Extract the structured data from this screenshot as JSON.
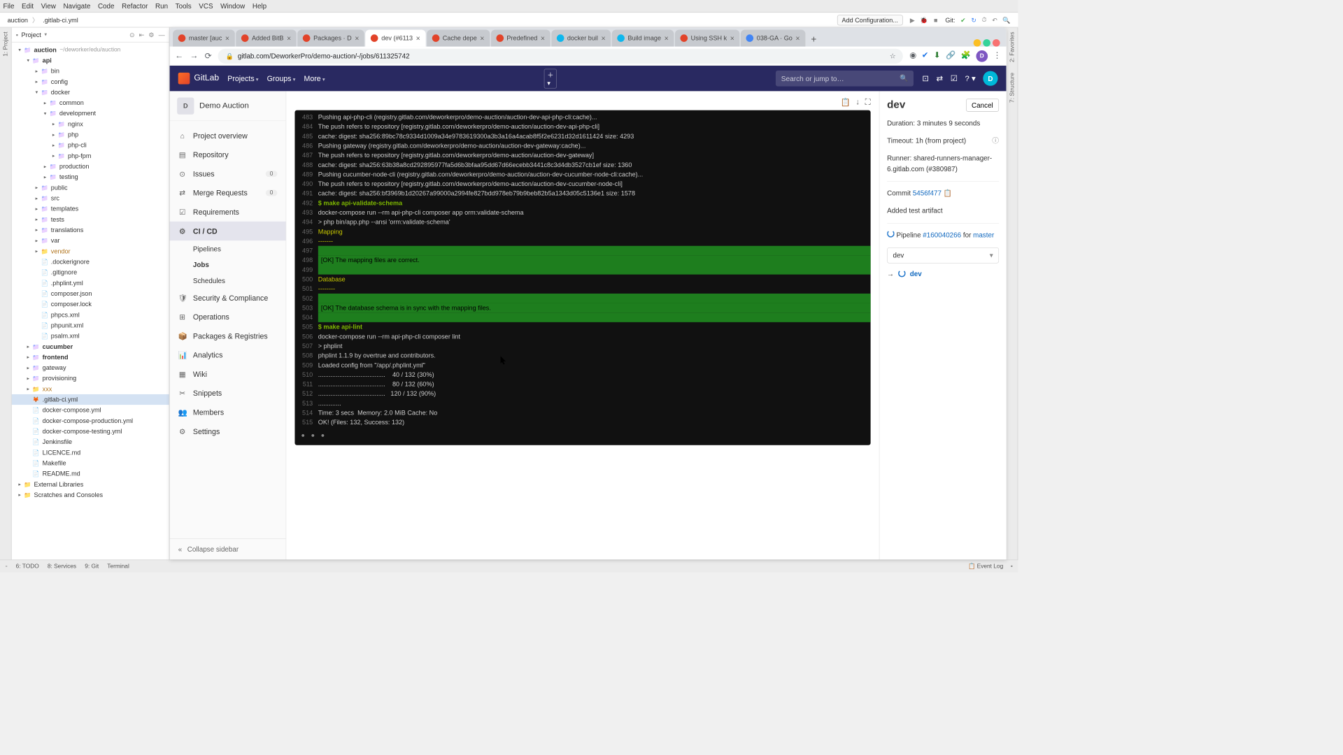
{
  "ide": {
    "menubar": [
      "File",
      "Edit",
      "View",
      "Navigate",
      "Code",
      "Refactor",
      "Run",
      "Tools",
      "VCS",
      "Window",
      "Help"
    ],
    "breadcrumb": {
      "project": "auction",
      "file": ".gitlab-ci.yml",
      "add_config": "Add Configuration...",
      "git": "Git:"
    },
    "gutter_left": [
      "1: Project"
    ],
    "gutter_left2": [
      "2: Favorites",
      "7: Structure"
    ],
    "sidebar_title": "Project",
    "tree": [
      {
        "d": 0,
        "a": "▾",
        "icon": "folder-blue",
        "t": "auction",
        "hint": "~/deworker/edu/auction",
        "bold": true
      },
      {
        "d": 1,
        "a": "▾",
        "icon": "folder-blue",
        "t": "api",
        "bold": true
      },
      {
        "d": 2,
        "a": "▸",
        "icon": "folder-blue",
        "t": "bin"
      },
      {
        "d": 2,
        "a": "▸",
        "icon": "folder-blue",
        "t": "config"
      },
      {
        "d": 2,
        "a": "▾",
        "icon": "folder-blue",
        "t": "docker"
      },
      {
        "d": 3,
        "a": "▸",
        "icon": "folder-blue",
        "t": "common"
      },
      {
        "d": 3,
        "a": "▾",
        "icon": "folder-blue",
        "t": "development"
      },
      {
        "d": 4,
        "a": "▸",
        "icon": "folder-blue",
        "t": "nginx"
      },
      {
        "d": 4,
        "a": "▸",
        "icon": "folder-blue",
        "t": "php"
      },
      {
        "d": 4,
        "a": "▸",
        "icon": "folder-blue",
        "t": "php-cli"
      },
      {
        "d": 4,
        "a": "▸",
        "icon": "folder-blue",
        "t": "php-fpm"
      },
      {
        "d": 3,
        "a": "▸",
        "icon": "folder-blue",
        "t": "production"
      },
      {
        "d": 3,
        "a": "▸",
        "icon": "folder-blue",
        "t": "testing"
      },
      {
        "d": 2,
        "a": "▸",
        "icon": "folder-blue",
        "t": "public"
      },
      {
        "d": 2,
        "a": "▸",
        "icon": "folder-blue",
        "t": "src"
      },
      {
        "d": 2,
        "a": "▸",
        "icon": "folder-blue",
        "t": "templates"
      },
      {
        "d": 2,
        "a": "▸",
        "icon": "folder-blue",
        "t": "tests"
      },
      {
        "d": 2,
        "a": "▸",
        "icon": "folder-blue",
        "t": "translations"
      },
      {
        "d": 2,
        "a": "▸",
        "icon": "folder-blue",
        "t": "var"
      },
      {
        "d": 2,
        "a": "▸",
        "icon": "folder-icon",
        "t": "vendor",
        "color": "#b07219"
      },
      {
        "d": 2,
        "a": "",
        "icon": "file-icon",
        "t": ".dockerignore"
      },
      {
        "d": 2,
        "a": "",
        "icon": "file-icon",
        "t": ".gitignore"
      },
      {
        "d": 2,
        "a": "",
        "icon": "file-icon",
        "t": ".phplint.yml"
      },
      {
        "d": 2,
        "a": "",
        "icon": "file-icon",
        "t": "composer.json"
      },
      {
        "d": 2,
        "a": "",
        "icon": "file-icon",
        "t": "composer.lock"
      },
      {
        "d": 2,
        "a": "",
        "icon": "file-icon",
        "t": "phpcs.xml"
      },
      {
        "d": 2,
        "a": "",
        "icon": "file-icon",
        "t": "phpunit.xml"
      },
      {
        "d": 2,
        "a": "",
        "icon": "file-icon",
        "t": "psalm.xml"
      },
      {
        "d": 1,
        "a": "▸",
        "icon": "folder-blue",
        "t": "cucumber",
        "bold": true
      },
      {
        "d": 1,
        "a": "▸",
        "icon": "folder-blue",
        "t": "frontend",
        "bold": true
      },
      {
        "d": 1,
        "a": "▸",
        "icon": "folder-blue",
        "t": "gateway"
      },
      {
        "d": 1,
        "a": "▸",
        "icon": "folder-blue",
        "t": "provisioning"
      },
      {
        "d": 1,
        "a": "▸",
        "icon": "folder-icon",
        "t": "xxx",
        "color": "#b07219"
      },
      {
        "d": 1,
        "a": "",
        "icon": "gitlab-file-icon",
        "t": ".gitlab-ci.yml",
        "sel": true
      },
      {
        "d": 1,
        "a": "",
        "icon": "file-icon",
        "t": "docker-compose.yml"
      },
      {
        "d": 1,
        "a": "",
        "icon": "file-icon",
        "t": "docker-compose-production.yml"
      },
      {
        "d": 1,
        "a": "",
        "icon": "file-icon",
        "t": "docker-compose-testing.yml"
      },
      {
        "d": 1,
        "a": "",
        "icon": "file-icon",
        "t": "Jenkinsfile"
      },
      {
        "d": 1,
        "a": "",
        "icon": "file-icon",
        "t": "LICENCE.md"
      },
      {
        "d": 1,
        "a": "",
        "icon": "file-icon",
        "t": "Makefile"
      },
      {
        "d": 1,
        "a": "",
        "icon": "file-icon",
        "t": "README.md"
      },
      {
        "d": 0,
        "a": "▸",
        "icon": "folder-icon",
        "t": "External Libraries"
      },
      {
        "d": 0,
        "a": "▸",
        "icon": "folder-icon",
        "t": "Scratches and Consoles"
      }
    ],
    "statusbar": {
      "todo": "6: TODO",
      "services": "8: Services",
      "git": "9: Git",
      "terminal": "Terminal",
      "eventlog": "Event Log"
    }
  },
  "browser": {
    "tabs": [
      {
        "t": "master [auc",
        "fav": "#e24329"
      },
      {
        "t": "Added BitB",
        "fav": "#e24329"
      },
      {
        "t": "Packages · D",
        "fav": "#e24329"
      },
      {
        "t": "dev (#6113",
        "fav": "#e24329",
        "active": true
      },
      {
        "t": "Cache depe",
        "fav": "#e24329"
      },
      {
        "t": "Predefined",
        "fav": "#e24329"
      },
      {
        "t": "docker buil",
        "fav": "#0db7ed"
      },
      {
        "t": "Build image",
        "fav": "#0db7ed"
      },
      {
        "t": "Using SSH k",
        "fav": "#e24329"
      },
      {
        "t": "038-GA · Go",
        "fav": "#4285f4"
      }
    ],
    "url": "gitlab.com/DeworkerPro/demo-auction/-/jobs/611325742"
  },
  "gitlab": {
    "brand": "GitLab",
    "topmenu": [
      "Projects",
      "Groups",
      "More"
    ],
    "search_ph": "Search or jump to…",
    "avatar": "D",
    "project": {
      "badge": "D",
      "name": "Demo Auction"
    },
    "nav": [
      {
        "ic": "⌂",
        "t": "Project overview"
      },
      {
        "ic": "▤",
        "t": "Repository"
      },
      {
        "ic": "⊙",
        "t": "Issues",
        "badge": "0"
      },
      {
        "ic": "⇄",
        "t": "Merge Requests",
        "badge": "0"
      },
      {
        "ic": "☑",
        "t": "Requirements"
      },
      {
        "ic": "⚙",
        "t": "CI / CD",
        "active": true,
        "subs": [
          {
            "t": "Pipelines"
          },
          {
            "t": "Jobs",
            "active": true
          },
          {
            "t": "Schedules"
          }
        ]
      },
      {
        "ic": "🛡",
        "t": "Security & Compliance"
      },
      {
        "ic": "⊞",
        "t": "Operations"
      },
      {
        "ic": "📦",
        "t": "Packages & Registries"
      },
      {
        "ic": "📊",
        "t": "Analytics"
      },
      {
        "ic": "▦",
        "t": "Wiki"
      },
      {
        "ic": "✂",
        "t": "Snippets"
      },
      {
        "ic": "👥",
        "t": "Members"
      },
      {
        "ic": "⚙",
        "t": "Settings"
      }
    ],
    "collapse": "Collapse sidebar",
    "log": [
      {
        "n": 483,
        "t": "Pushing api-php-cli (registry.gitlab.com/deworkerpro/demo-auction/auction-dev-api-php-cli:cache)..."
      },
      {
        "n": 484,
        "t": "The push refers to repository [registry.gitlab.com/deworkerpro/demo-auction/auction-dev-api-php-cli]"
      },
      {
        "n": 485,
        "t": "cache: digest: sha256:89bc78c9334d1009a34e9783619300a3b3a16a4acab8f5f2e6231d32d1611424 size: 4293"
      },
      {
        "n": 486,
        "t": "Pushing gateway (registry.gitlab.com/deworkerpro/demo-auction/auction-dev-gateway:cache)..."
      },
      {
        "n": 487,
        "t": "The push refers to repository [registry.gitlab.com/deworkerpro/demo-auction/auction-dev-gateway]"
      },
      {
        "n": 488,
        "t": "cache: digest: sha256:63b38a8cd292895977fa5d6b3bfaa95dd67d66ecebb3441c8c3d4db3527cb1ef size: 1360"
      },
      {
        "n": 489,
        "t": "Pushing cucumber-node-cli (registry.gitlab.com/deworkerpro/demo-auction/auction-dev-cucumber-node-cli:cache)..."
      },
      {
        "n": 490,
        "t": "The push refers to repository [registry.gitlab.com/deworkerpro/demo-auction/auction-dev-cucumber-node-cli]"
      },
      {
        "n": 491,
        "t": "cache: digest: sha256:bf3969b1d20267a99000a2994fe827bdd978eb79b9beb82b5a1343d05c5136e1 size: 1578"
      },
      {
        "n": 492,
        "t": "$ make api-validate-schema",
        "cls": "cmd"
      },
      {
        "n": 493,
        "t": "docker-compose run --rm api-php-cli composer app orm:validate-schema"
      },
      {
        "n": 494,
        "t": "> php bin/app.php --ansi 'orm:validate-schema'"
      },
      {
        "n": 495,
        "t": "Mapping",
        "cls": "yellow"
      },
      {
        "n": 496,
        "t": "-------",
        "cls": "yellow"
      },
      {
        "n": 497,
        "t": " ",
        "cls": "greenblock"
      },
      {
        "n": 498,
        "t": " [OK] The mapping files are correct. ",
        "cls": "greenblock"
      },
      {
        "n": 499,
        "t": " ",
        "cls": "greenblock"
      },
      {
        "n": 500,
        "t": "Database",
        "cls": "yellow"
      },
      {
        "n": 501,
        "t": "--------",
        "cls": "yellow"
      },
      {
        "n": 502,
        "t": " ",
        "cls": "greenblock"
      },
      {
        "n": 503,
        "t": " [OK] The database schema is in sync with the mapping files. ",
        "cls": "greenblock"
      },
      {
        "n": 504,
        "t": " ",
        "cls": "greenblock"
      },
      {
        "n": 505,
        "t": "$ make api-lint",
        "cls": "cmd"
      },
      {
        "n": 506,
        "t": "docker-compose run --rm api-php-cli composer lint"
      },
      {
        "n": 507,
        "t": "> phplint"
      },
      {
        "n": 508,
        "t": "phplint 1.1.9 by overtrue and contributors."
      },
      {
        "n": 509,
        "t": "Loaded config from \"/app/.phplint.yml\""
      },
      {
        "n": 510,
        "t": "......................................    40 / 132 (30%)"
      },
      {
        "n": 511,
        "t": "......................................    80 / 132 (60%)"
      },
      {
        "n": 512,
        "t": "......................................   120 / 132 (90%)"
      },
      {
        "n": 513,
        "t": "............."
      },
      {
        "n": 514,
        "t": "Time: 3 secs  Memory: 2.0 MiB Cache: No"
      },
      {
        "n": 515,
        "t": "OK! (Files: 132, Success: 132)"
      }
    ],
    "job": {
      "title": "dev",
      "cancel": "Cancel",
      "duration_lbl": "Duration:",
      "duration": "3 minutes 9 seconds",
      "timeout_lbl": "Timeout:",
      "timeout": "1h (from project)",
      "runner_lbl": "Runner:",
      "runner": "shared-runners-manager-6.gitlab.com (#380987)",
      "commit_lbl": "Commit",
      "commit": "5456f477",
      "artifact": "Added test artifact",
      "pipeline_lbl": "Pipeline",
      "pipeline": "#160040266",
      "for": "for",
      "branch": "master",
      "select": "dev",
      "stage": "dev"
    }
  }
}
